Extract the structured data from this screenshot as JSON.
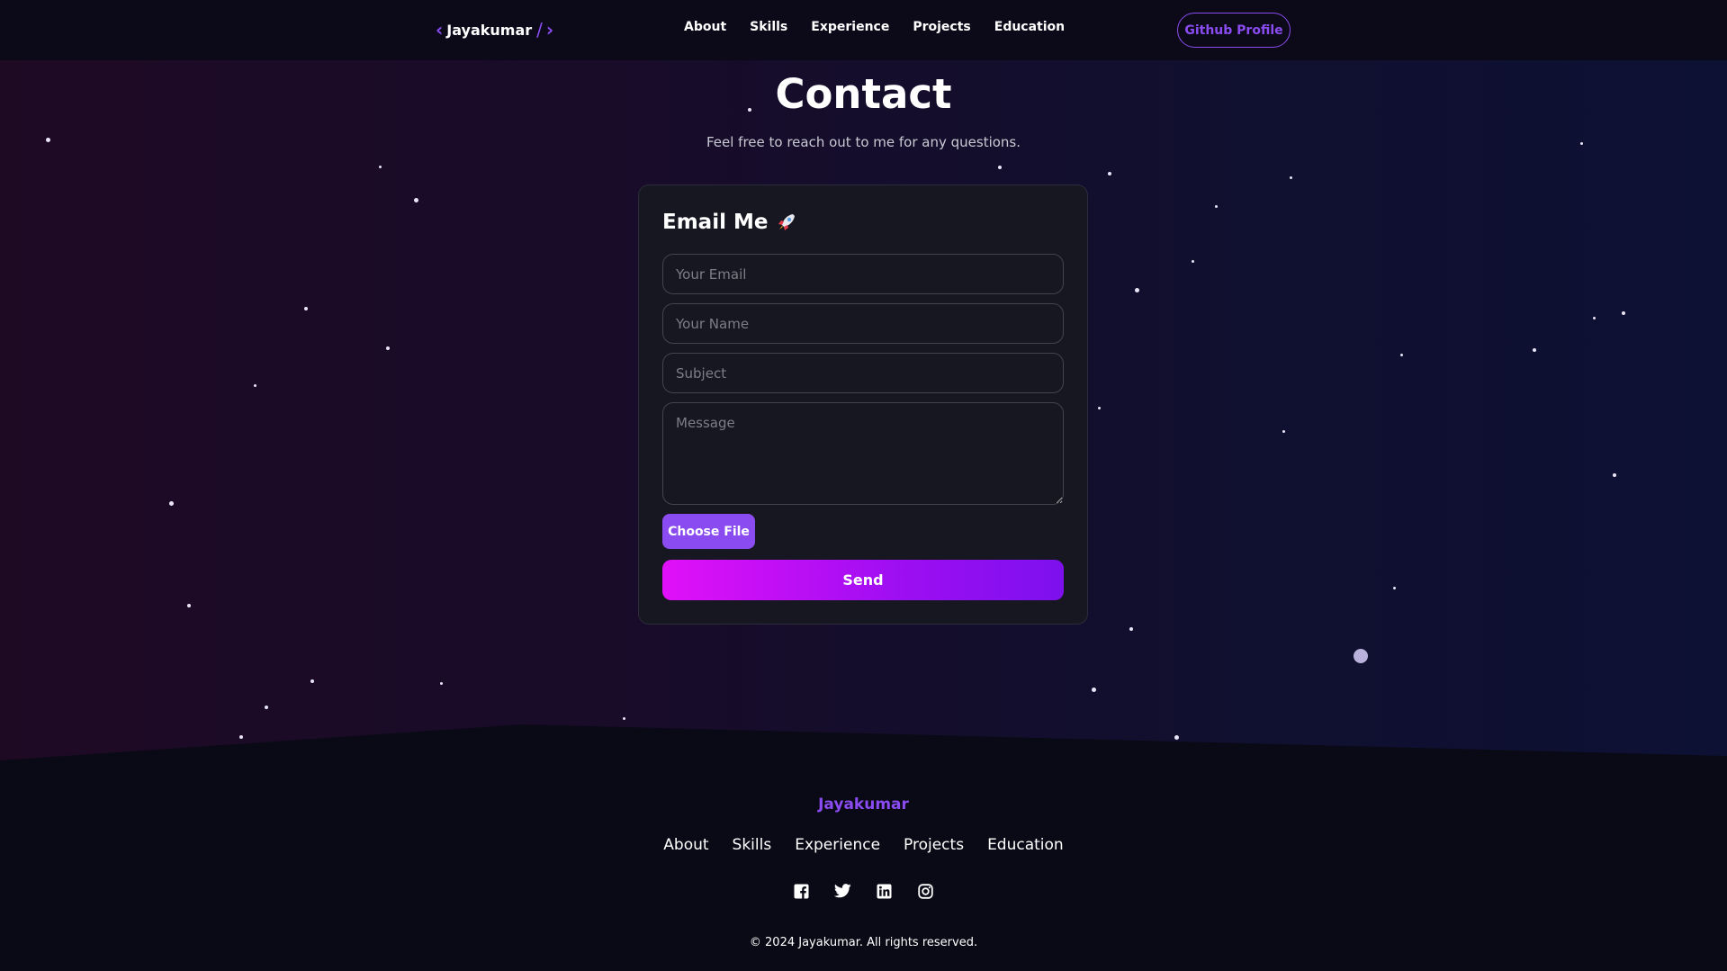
{
  "header": {
    "brand": "Jayakumar",
    "nav": [
      "About",
      "Skills",
      "Experience",
      "Projects",
      "Education"
    ],
    "github_button": "Github Profile"
  },
  "contact": {
    "title": "Contact",
    "subtitle": "Feel free to reach out to me for any questions.",
    "form": {
      "heading": "Email Me",
      "email_placeholder": "Your Email",
      "name_placeholder": "Your Name",
      "subject_placeholder": "Subject",
      "message_placeholder": "Message",
      "file_button": "Choose File",
      "send_button": "Send"
    }
  },
  "footer": {
    "name": "Jayakumar",
    "links": [
      "About",
      "Skills",
      "Experience",
      "Projects",
      "Education"
    ],
    "socials": [
      "facebook-icon",
      "twitter-icon",
      "linkedin-icon",
      "instagram-icon"
    ],
    "copyright": "© 2024 Jayakumar. All rights reserved."
  },
  "colors": {
    "accent": "#8a4cf0",
    "send_gradient_start": "#e110f8",
    "send_gradient_end": "#7d10ee",
    "background": "#090917"
  }
}
